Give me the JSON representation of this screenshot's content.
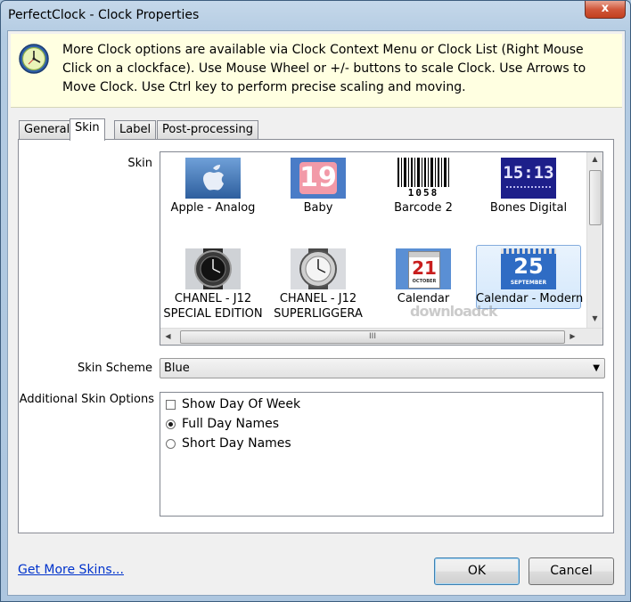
{
  "window": {
    "title": "PerfectClock - Clock Properties",
    "close_glyph": "x"
  },
  "banner": {
    "icon": "clock-icon",
    "text": "More Clock options are available via Clock Context Menu or Clock List (Right Mouse Click on a clockface). Use Mouse Wheel or +/- buttons to scale Clock. Use Arrows to Move Clock. Use Ctrl key to perform precise scaling and moving."
  },
  "tabs": [
    {
      "label": "General"
    },
    {
      "label": "Skin",
      "active": true
    },
    {
      "label": "Label"
    },
    {
      "label": "Post-processing"
    }
  ],
  "skin": {
    "label": "Skin",
    "items": [
      {
        "line1": "Apple - Analog",
        "line2": "",
        "thumb": "apple-logo"
      },
      {
        "line1": "Baby",
        "line2": "",
        "thumb": "digits-19"
      },
      {
        "line1": "Barcode 2",
        "line2": "",
        "thumb": "barcode"
      },
      {
        "line1": "Bones Digital",
        "line2": "",
        "thumb": "bones-1513"
      },
      {
        "line1": "CHANEL - J12",
        "line2": "SPECIAL EDITION",
        "thumb": "watch-black"
      },
      {
        "line1": "CHANEL - J12",
        "line2": "SUPERLIGGERA",
        "thumb": "watch-silver"
      },
      {
        "line1": "Calendar",
        "line2": "",
        "thumb": "calendar-21"
      },
      {
        "line1": "Calendar - Modern",
        "line2": "",
        "thumb": "calendar-25",
        "selected": true
      }
    ],
    "thumb_text": {
      "baby": "19",
      "barcode_digits": "1058",
      "bones": "15:13",
      "calendar_day": "21",
      "calendar_month": "OCTOBER",
      "modern_day": "25",
      "modern_month": "SEPTEMBER"
    },
    "hscroll_grip": "III"
  },
  "scheme": {
    "label": "Skin Scheme",
    "value": "Blue"
  },
  "additional": {
    "label": "Additional Skin Options",
    "options": [
      {
        "label": "Show Day Of Week",
        "type": "checkbox",
        "checked": false
      },
      {
        "label": "Full Day Names",
        "type": "radio",
        "checked": true
      },
      {
        "label": "Short Day Names",
        "type": "radio",
        "checked": false
      }
    ]
  },
  "footer": {
    "link": "Get More Skins...",
    "ok": "OK",
    "cancel": "Cancel"
  },
  "watermark": "downloadck"
}
